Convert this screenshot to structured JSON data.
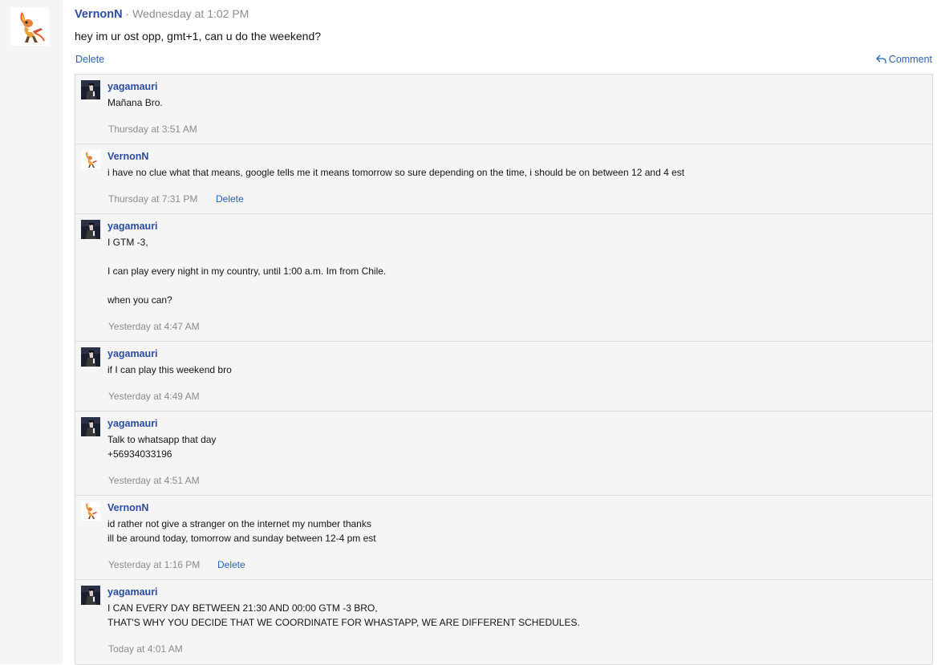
{
  "post": {
    "author": "VernonN",
    "separator": "·",
    "time": "Wednesday at 1:02 PM",
    "text": "hey im ur ost opp, gmt+1, can u do the weekend?",
    "delete_label": "Delete",
    "comment_label": "Comment"
  },
  "comments": [
    {
      "author": "yagamauri",
      "lines": [
        "Mañana Bro."
      ],
      "time": "Thursday at 3:51 AM"
    },
    {
      "author": "VernonN",
      "lines": [
        "i have no clue what that means, google tells me it means tomorrow so sure depending on the time, i should be on between 12 and 4 est"
      ],
      "time": "Thursday at 7:31 PM",
      "delete_label": "Delete"
    },
    {
      "author": "yagamauri",
      "lines": [
        "I GTM -3,",
        "",
        "I can play every night in my country, until 1:00 a.m. Im from Chile.",
        "",
        "when you can?"
      ],
      "time": "Yesterday at 4:47 AM"
    },
    {
      "author": "yagamauri",
      "lines": [
        "if I can play this weekend bro"
      ],
      "time": "Yesterday at 4:49 AM"
    },
    {
      "author": "yagamauri",
      "lines": [
        "Talk to whatsapp that day",
        "+56934033196"
      ],
      "time": "Yesterday at 4:51 AM"
    },
    {
      "author": "VernonN",
      "lines": [
        "id rather not give a stranger on the internet my number thanks",
        "ill be around today, tomorrow and sunday between 12-4 pm est"
      ],
      "time": "Yesterday at 1:16 PM",
      "delete_label": "Delete"
    },
    {
      "author": "yagamauri",
      "lines": [
        "I CAN EVERY DAY BETWEEN 21:30 AND 00:00 GTM -3 BRO,",
        "THAT'S WHY YOU DECIDE THAT WE COORDINATE FOR WHASTAPP, WE ARE DIFFERENT SCHEDULES."
      ],
      "time": "Today at 4:01 AM"
    }
  ]
}
